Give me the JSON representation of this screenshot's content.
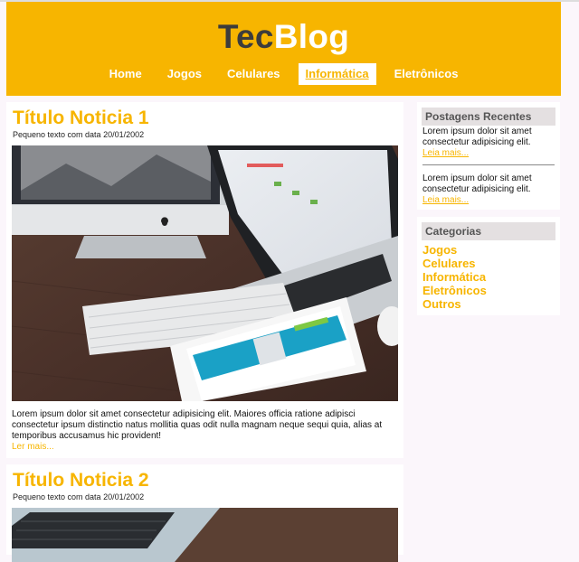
{
  "brand": {
    "part1": "Tec",
    "part2": "Blog",
    "color_accent": "#f7b500"
  },
  "nav": {
    "items": [
      {
        "label": "Home"
      },
      {
        "label": "Jogos"
      },
      {
        "label": "Celulares"
      },
      {
        "label": "Informática",
        "active": true
      },
      {
        "label": "Eletrônicos"
      }
    ]
  },
  "posts": [
    {
      "title": "Título Noticia 1",
      "meta": "Pequeno texto com data 20/01/2002",
      "image": "desk-computers-photo",
      "excerpt": "Lorem ipsum dolor sit amet consectetur adipisicing elit. Maiores officia ratione adipisci consectetur ipsum distinctio natus mollitia quas odit nulla magnam neque sequi quia, alias at temporibus accusamus hic provident!",
      "more": "Ler mais..."
    },
    {
      "title": "Título Noticia 2",
      "meta": "Pequeno texto com data 20/01/2002",
      "image": "laptop-keyboard-photo"
    }
  ],
  "sidebar": {
    "recent": {
      "title": "Postagens Recentes",
      "items": [
        {
          "text": "Lorem ipsum dolor sit amet consectetur adipisicing elit.",
          "more": "Leia mais..."
        },
        {
          "text": "Lorem ipsum dolor sit amet consectetur adipisicing elit.",
          "more": "Leia mais..."
        }
      ]
    },
    "categories": {
      "title": "Categorias",
      "items": [
        "Jogos",
        "Celulares",
        "Informática",
        "Eletrônicos",
        "Outros"
      ]
    }
  }
}
